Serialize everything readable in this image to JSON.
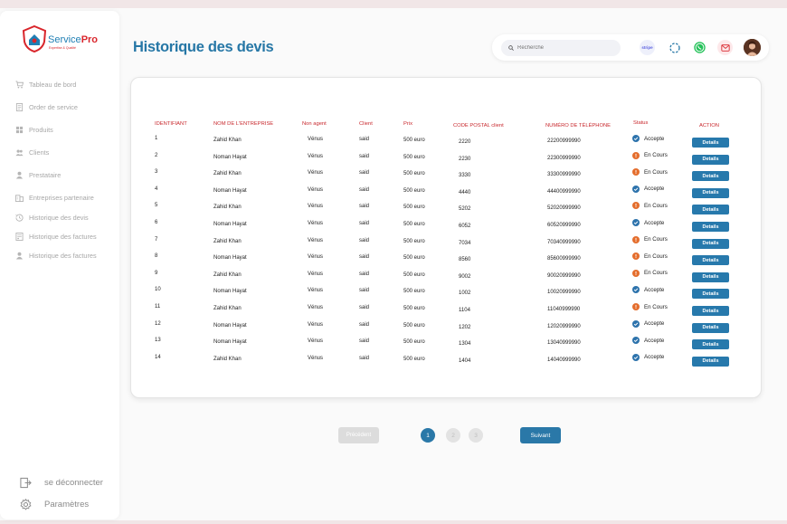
{
  "app": {
    "name_prefix": "Service",
    "name_suffix": "Pro",
    "tagline": "Expertise & Qualité"
  },
  "sidebar": {
    "items": [
      {
        "label": "Tableau de bord",
        "icon": "cart-icon"
      },
      {
        "label": "Order de service",
        "icon": "document-icon"
      },
      {
        "label": "Produits",
        "icon": "grid-icon"
      },
      {
        "label": "Clients",
        "icon": "users-icon"
      },
      {
        "label": "Prestataire",
        "icon": "user-icon"
      },
      {
        "label": "Entreprises partenaire",
        "icon": "building-icon"
      },
      {
        "label": "Historique des devis",
        "icon": "history-icon"
      },
      {
        "label": "Historique des factures",
        "icon": "invoice-icon"
      },
      {
        "label": "Historique des factures",
        "icon": "user-icon"
      }
    ],
    "logout_label": "se déconnecter",
    "settings_label": "Paramètres"
  },
  "header": {
    "title": "Historique des devis",
    "search_placeholder": "Recherche",
    "stripe_label": "stripe"
  },
  "table": {
    "columns": [
      "IDENTIFIANT",
      "NOM DE L'ENTREPRISE",
      "Non agent",
      "Client",
      "Prix",
      "CODE POSTAL client",
      "NUMÉRO DE TÉLÉPHONE",
      "Status",
      "ACTION"
    ],
    "rows": [
      {
        "id": "1",
        "company": "Zahid Khan",
        "agent": "Vénus",
        "client": "said",
        "price": "500 euro",
        "postal": "2220",
        "phone": "22200999990",
        "status": "Accepte",
        "status_type": "ok",
        "action": "Details"
      },
      {
        "id": "2",
        "company": "Noman Hayat",
        "agent": "Vénus",
        "client": "said",
        "price": "500 euro",
        "postal": "2230",
        "phone": "22300999990",
        "status": "En Cours",
        "status_type": "wait",
        "action": "Details"
      },
      {
        "id": "3",
        "company": "Zahid Khan",
        "agent": "Vénus",
        "client": "said",
        "price": "500 euro",
        "postal": "3330",
        "phone": "33300999990",
        "status": "En Cours",
        "status_type": "wait",
        "action": "Details"
      },
      {
        "id": "4",
        "company": "Noman Hayat",
        "agent": "Vénus",
        "client": "said",
        "price": "500 euro",
        "postal": "4440",
        "phone": "44400999990",
        "status": "Accepte",
        "status_type": "ok",
        "action": "Details"
      },
      {
        "id": "5",
        "company": "Zahid Khan",
        "agent": "Vénus",
        "client": "said",
        "price": "500 euro",
        "postal": "5202",
        "phone": "52020999990",
        "status": "En Cours",
        "status_type": "wait",
        "action": "Details"
      },
      {
        "id": "6",
        "company": "Noman Hayat",
        "agent": "Vénus",
        "client": "said",
        "price": "500 euro",
        "postal": "6052",
        "phone": "60520999990",
        "status": "Accepte",
        "status_type": "ok",
        "action": "Details"
      },
      {
        "id": "7",
        "company": "Zahid Khan",
        "agent": "Vénus",
        "client": "said",
        "price": "500 euro",
        "postal": "7034",
        "phone": "70340999990",
        "status": "En Cours",
        "status_type": "wait",
        "action": "Details"
      },
      {
        "id": "8",
        "company": "Noman Hayat",
        "agent": "Vénus",
        "client": "said",
        "price": "500 euro",
        "postal": "8560",
        "phone": "85600999990",
        "status": "En Cours",
        "status_type": "wait",
        "action": "Details"
      },
      {
        "id": "9",
        "company": "Zahid Khan",
        "agent": "Vénus",
        "client": "said",
        "price": "500 euro",
        "postal": "9002",
        "phone": "90020999990",
        "status": "En Cours",
        "status_type": "wait",
        "action": "Details"
      },
      {
        "id": "10",
        "company": "Noman Hayat",
        "agent": "Vénus",
        "client": "said",
        "price": "500 euro",
        "postal": "1002",
        "phone": "10020999990",
        "status": "Accepte",
        "status_type": "ok",
        "action": "Details"
      },
      {
        "id": "11",
        "company": "Zahid Khan",
        "agent": "Vénus",
        "client": "said",
        "price": "500 euro",
        "postal": "1104",
        "phone": "11040999990",
        "status": "En Cours",
        "status_type": "wait",
        "action": "Details"
      },
      {
        "id": "12",
        "company": "Noman Hayat",
        "agent": "Vénus",
        "client": "said",
        "price": "500 euro",
        "postal": "1202",
        "phone": "12020999990",
        "status": "Accepte",
        "status_type": "ok",
        "action": "Details"
      },
      {
        "id": "13",
        "company": "Noman Hayat",
        "agent": "Vénus",
        "client": "said",
        "price": "500 euro",
        "postal": "1304",
        "phone": "13040999990",
        "status": "Accepte",
        "status_type": "ok",
        "action": "Details"
      },
      {
        "id": "14",
        "company": "Zahid Khan",
        "agent": "Vénus",
        "client": "said",
        "price": "500 euro",
        "postal": "1404",
        "phone": "14040999990",
        "status": "Accepte",
        "status_type": "ok",
        "action": "Details"
      }
    ]
  },
  "pagination": {
    "prev_label": "Précédent",
    "next_label": "Suivant",
    "pages": [
      "1",
      "2",
      "3"
    ],
    "current": "1"
  },
  "colors": {
    "accent": "#2779ac",
    "header_text": "#c8282d",
    "status_ok": "#2d73ac",
    "status_wait": "#e46d2c",
    "background": "#f1e6e7"
  }
}
